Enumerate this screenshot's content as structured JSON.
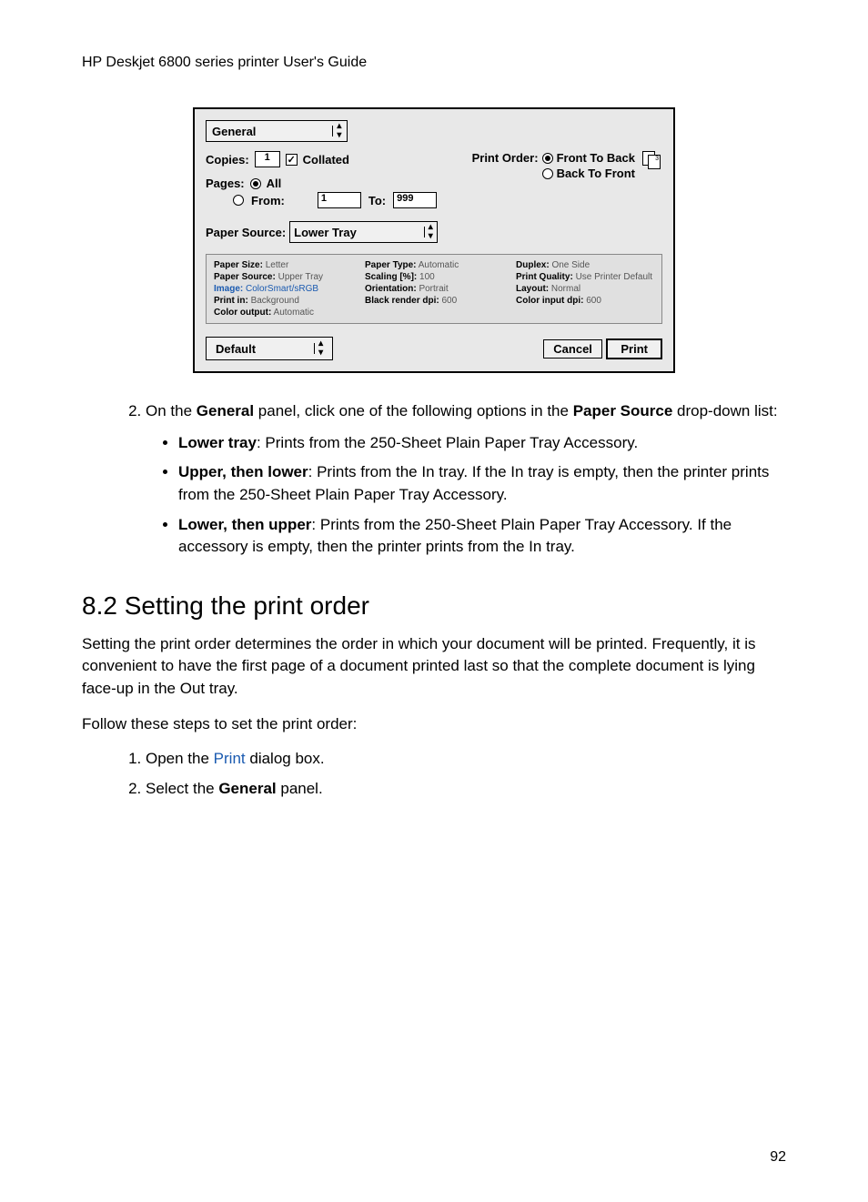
{
  "header": {
    "title": "HP Deskjet 6800 series printer User's Guide"
  },
  "dialog": {
    "tab": "General",
    "copies_label": "Copies:",
    "copies_value": "1",
    "collated_label": "Collated",
    "print_order_label": "Print Order:",
    "front_to_back": "Front To Back",
    "back_to_front": "Back To Front",
    "pages_label": "Pages:",
    "all_label": "All",
    "from_label": "From:",
    "from_value": "1",
    "to_label": "To:",
    "to_value": "999",
    "paper_source_label": "Paper Source:",
    "paper_source_value": "Lower Tray",
    "summary": {
      "paper_size_l": "Paper Size:",
      "paper_size_v": "Letter",
      "paper_type_l": "Paper Type:",
      "paper_type_v": "Automatic",
      "duplex_l": "Duplex:",
      "duplex_v": "One Side",
      "paper_source_l": "Paper Source:",
      "paper_source_v": "Upper Tray",
      "scaling_l": "Scaling [%]:",
      "scaling_v": "100",
      "print_quality_l": "Print Quality:",
      "print_quality_v": "Use Printer Default",
      "image_l": "Image:",
      "image_v": "ColorSmart/sRGB",
      "orientation_l": "Orientation:",
      "orientation_v": "Portrait",
      "layout_l": "Layout:",
      "layout_v": "Normal",
      "print_in_l": "Print in:",
      "print_in_v": "Background",
      "black_dpi_l": "Black render dpi:",
      "black_dpi_v": "600",
      "color_dpi_l": "Color input dpi:",
      "color_dpi_v": "600",
      "color_output_l": "Color output:",
      "color_output_v": "Automatic"
    },
    "preset": "Default",
    "cancel": "Cancel",
    "print": "Print"
  },
  "step2": {
    "number": "2.",
    "intro_pre": "On the ",
    "general": "General",
    "intro_mid": " panel, click one of the following options in the ",
    "paper_source": "Paper Source",
    "intro_post": " drop-down list:",
    "bullets": [
      {
        "bold": "Lower tray",
        "text": ": Prints from the 250-Sheet Plain Paper Tray Accessory."
      },
      {
        "bold": "Upper, then lower",
        "text": ": Prints from the In tray. If the In tray is empty, then the printer prints from the 250-Sheet Plain Paper Tray Accessory."
      },
      {
        "bold": "Lower, then upper",
        "text": ": Prints from the 250-Sheet Plain Paper Tray Accessory. If the accessory is empty, then the printer prints from the In tray."
      }
    ]
  },
  "section": {
    "heading": "8.2  Setting the print order",
    "para1": "Setting the print order determines the order in which your document will be printed. Frequently, it is convenient to have the first page of a document printed last so that the complete document is lying face-up in the Out tray.",
    "para2": "Follow these steps to set the print order:",
    "steps": {
      "s1_pre": "Open the ",
      "s1_link": "Print",
      "s1_post": " dialog box.",
      "s2_pre": "Select the ",
      "s2_bold": "General",
      "s2_post": " panel."
    }
  },
  "page_number": "92"
}
